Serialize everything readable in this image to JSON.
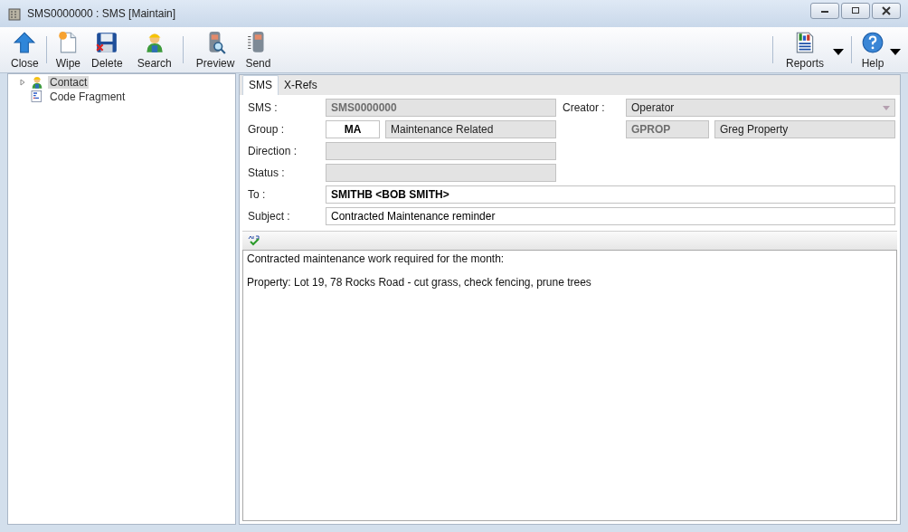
{
  "window": {
    "title": "SMS0000000 : SMS [Maintain]"
  },
  "toolbar": {
    "groups": [
      [
        {
          "label": "Close"
        }
      ],
      [
        {
          "label": "Wipe"
        },
        {
          "label": "Delete"
        },
        {
          "label": "Search"
        }
      ],
      [
        {
          "label": "Preview"
        },
        {
          "label": "Send"
        }
      ]
    ],
    "right": [
      {
        "label": "Reports"
      },
      {
        "label": "Help"
      }
    ]
  },
  "tree": [
    {
      "label": "Contact",
      "selected": true,
      "expanded": false
    },
    {
      "label": "Code Fragment",
      "selected": false
    }
  ],
  "tabs": [
    {
      "label": "SMS",
      "selected": true
    },
    {
      "label": "X-Refs",
      "selected": false
    }
  ],
  "form": {
    "sms": {
      "label": "SMS :",
      "value": "SMS0000000",
      "disabled": true
    },
    "creator": {
      "label": "Creator :",
      "value": "Operator",
      "disabled": true
    },
    "group": {
      "label": "Group :",
      "code": {
        "value": "MA",
        "disabled": false
      },
      "name": {
        "value": "Maintenance Related",
        "disabled": true
      }
    },
    "owner": {
      "code": {
        "value": "GPROP",
        "disabled": true
      },
      "name": {
        "value": "Greg Property",
        "disabled": true
      }
    },
    "direction": {
      "label": "Direction :",
      "disabled": true
    },
    "status": {
      "label": "Status :",
      "disabled": true
    },
    "to": {
      "label": "To :",
      "value": "SMITHB <BOB SMITH>",
      "disabled": false
    },
    "subject": {
      "label": "Subject :",
      "value": "Contracted Maintenance reminder",
      "disabled": false
    }
  },
  "message": {
    "lines": [
      "Contracted maintenance work required for the month:",
      "Property: Lot 19, 78 Rocks Road - cut grass, check fencing, prune trees"
    ]
  }
}
